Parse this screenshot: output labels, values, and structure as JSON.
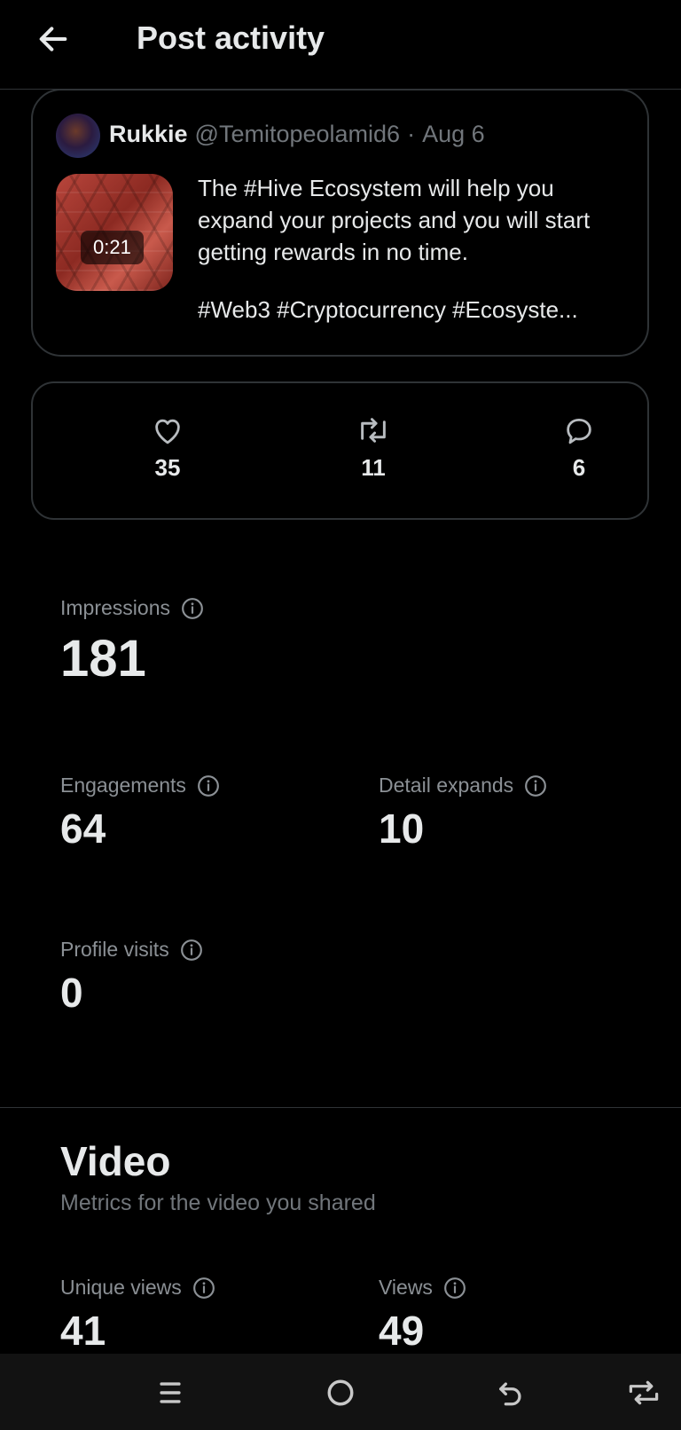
{
  "header": {
    "title": "Post activity"
  },
  "post": {
    "author_name": "Rukkie",
    "handle": "@Temitopeolamid6",
    "separator": "·",
    "date": "Aug 6",
    "video_duration": "0:21",
    "text": "The #Hive Ecosystem will help you expand your projects and you will start getting rewards in no time.",
    "tags": "#Web3   #Cryptocurrency #Ecosyste..."
  },
  "stats": {
    "likes": "35",
    "reposts": "11",
    "replies": "6"
  },
  "metrics": {
    "impressions": {
      "label": "Impressions",
      "value": "181"
    },
    "engagements": {
      "label": "Engagements",
      "value": "64"
    },
    "detail_expands": {
      "label": "Detail expands",
      "value": "10"
    },
    "profile_visits": {
      "label": "Profile visits",
      "value": "0"
    }
  },
  "video": {
    "title": "Video",
    "subtitle": "Metrics for the video you shared",
    "unique_views": {
      "label": "Unique views",
      "value": "41"
    },
    "views": {
      "label": "Views",
      "value": "49"
    }
  }
}
